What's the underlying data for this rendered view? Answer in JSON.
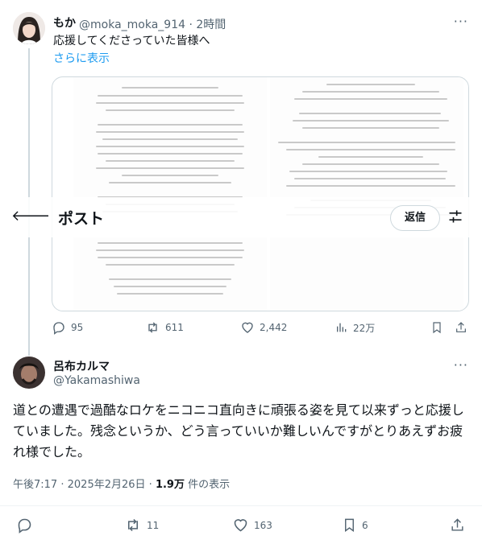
{
  "parent": {
    "author_name": "もか",
    "author_handle": "@moka_moka_914",
    "separator": "·",
    "time": "2時間",
    "text": "応援してくださっていた皆様へ",
    "show_more": "さらに表示",
    "stats": {
      "replies": "95",
      "reposts": "611",
      "likes": "2,442",
      "views": "22万"
    }
  },
  "nav": {
    "title": "ポスト",
    "reply_button": "返信"
  },
  "quote": {
    "author_name": "呂布カルマ",
    "author_handle": "@Yakamashiwa",
    "text": "道との遭遇で過酷なロケをニコニコ直向きに頑張る姿を見て以来ずっと応援していました。残念というか、どう言っていいか難しいんですがとりあえずお疲れ様でした。",
    "meta": {
      "time": "午後7:17",
      "sep1": "·",
      "date": "2025年2月26日",
      "sep2": "·",
      "views_count": "1.9万",
      "views_label": " 件の表示"
    },
    "stats": {
      "replies": "",
      "reposts": "11",
      "likes": "163",
      "bookmarks": "6"
    }
  },
  "colors": {
    "accent": "#1d9bf0",
    "text": "#0f1419",
    "muted": "#536471",
    "border": "#cfd9de"
  },
  "icons": [
    "back-arrow-icon",
    "more-icon",
    "reply-icon",
    "repost-icon",
    "like-icon",
    "views-icon",
    "bookmark-icon",
    "share-icon",
    "tune-icon"
  ]
}
